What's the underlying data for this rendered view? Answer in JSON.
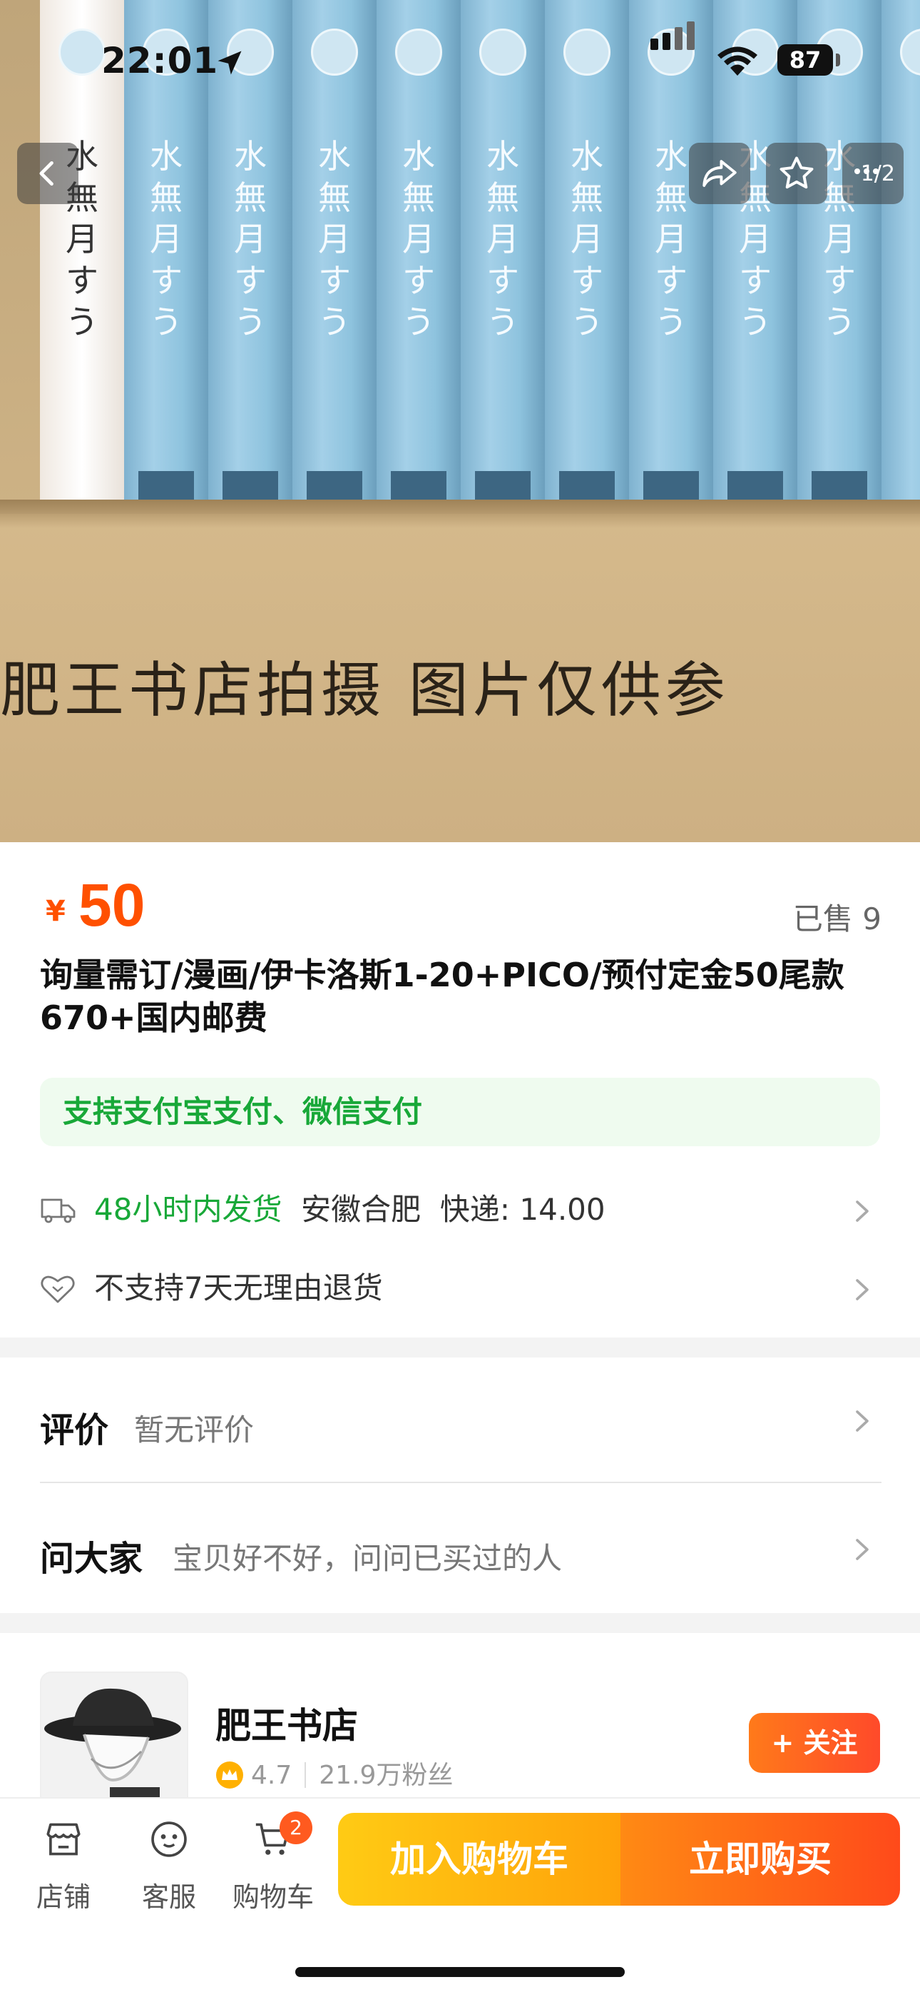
{
  "status_bar": {
    "time": "22:01",
    "battery": "87"
  },
  "hero": {
    "spine_text": "水無月すう",
    "caption": "肥王书店拍摄  图片仅供参",
    "page_indicator": "1/2"
  },
  "product": {
    "currency": "¥",
    "price": "50",
    "sold": "已售 9",
    "title": "询量需订/漫画/伊卡洛斯1-20+PICO/预付定金50尾款670+国内邮费",
    "payment_note": "支持支付宝支付、微信支付",
    "shipping_time": "48小时内发货",
    "shipping_origin": "安徽合肥",
    "shipping_fee": "快递: 14.00",
    "return_policy": "不支持7天无理由退货"
  },
  "reviews": {
    "label": "评价",
    "summary": "暂无评价"
  },
  "qa": {
    "label": "问大家",
    "prompt": "宝贝好不好，问问已买过的人"
  },
  "shop": {
    "name": "肥王书店",
    "rating": "4.7",
    "fans": "21.9万粉丝",
    "follow_label": "+ 关注"
  },
  "bottom_bar": {
    "store_label": "店铺",
    "service_label": "客服",
    "cart_label": "购物车",
    "cart_count": "2",
    "add_to_cart": "加入购物车",
    "buy_now": "立即购买"
  },
  "colors": {
    "accent": "#ff5000",
    "green": "#18a838",
    "cart_button": "#ffb50f",
    "buy_button": "#ff5a1a"
  },
  "icons": {
    "back": "chevron-left-icon",
    "share": "share-icon",
    "favorite": "star-icon",
    "truck": "truck-icon",
    "heart": "heart-icon",
    "store": "store-icon",
    "service": "service-icon",
    "cart": "cart-icon",
    "crown": "crown-icon"
  }
}
